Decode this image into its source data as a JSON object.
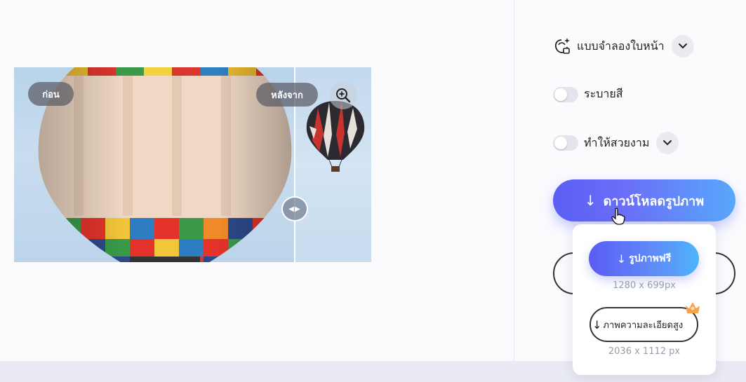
{
  "preview": {
    "before_label": "ก่อน",
    "after_label": "หลังจาก",
    "zoom_icon": "zoom-in-icon",
    "split_handle_icon": "left-right-arrows-icon"
  },
  "options": {
    "template": {
      "label": "แบบจำลองใบหน้า",
      "icon": "face-template-icon",
      "expand_icon": "chevron-down-icon"
    },
    "color": {
      "label": "ระบายสี",
      "enabled": false
    },
    "beautify": {
      "label": "ทำให้สวยงาม",
      "enabled": false,
      "expand_icon": "chevron-down-icon"
    }
  },
  "download": {
    "main_label": "ดาวน์โหลดรูปภาพ",
    "arrow_icon": "download-arrow-icon",
    "menu": {
      "free": {
        "label": "รูปภาพฟรี",
        "size": "1280 x 699px"
      },
      "hd": {
        "label": "ภาพความละเอียดสูง",
        "size": "2036 x 1112 px",
        "badge_icon": "crown-icon"
      }
    }
  },
  "colors": {
    "accent_start": "#5a5ef5",
    "accent_end": "#58a8fb",
    "crown": "#f5a34a"
  }
}
